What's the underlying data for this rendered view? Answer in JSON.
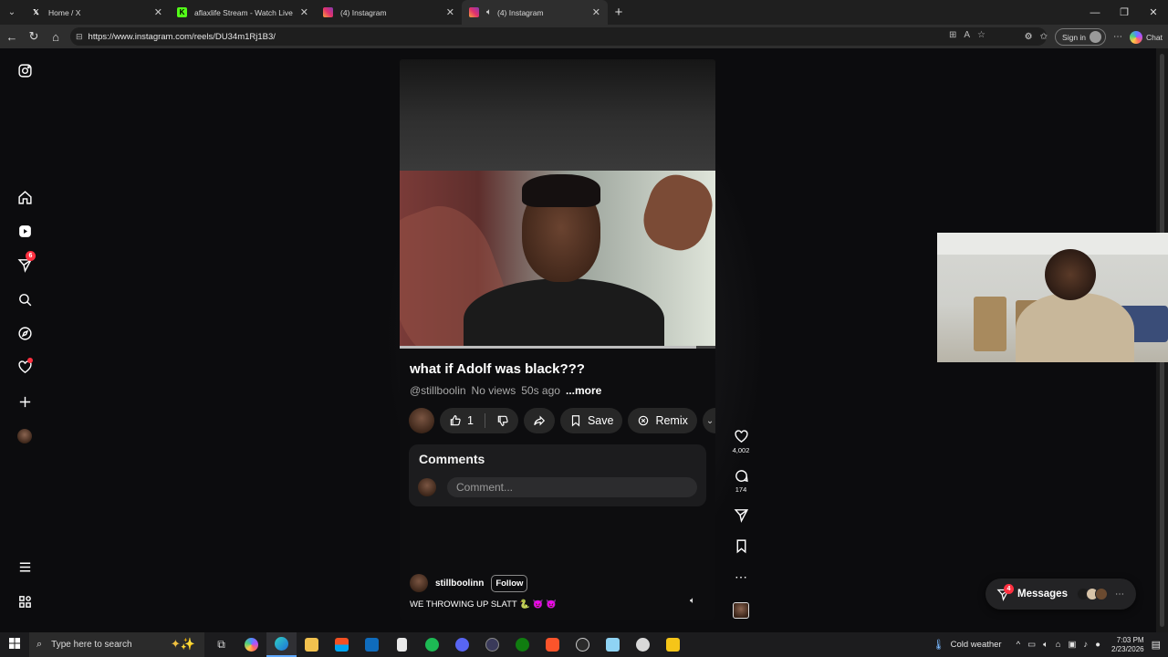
{
  "browser": {
    "tabs": [
      {
        "title": "Home / X",
        "favicon": "x-logo-icon",
        "active": false
      },
      {
        "title": "aflaxlife Stream - Watch Live on Ki",
        "favicon": "kick-logo-icon",
        "active": false
      },
      {
        "title": "(4) Instagram",
        "favicon": "instagram-logo-icon",
        "active": false
      },
      {
        "title": "(4) Instagram",
        "favicon": "instagram-logo-icon",
        "active": true
      }
    ],
    "url": "https://www.instagram.com/reels/DU34m1Rj1B3/",
    "sign_in_label": "Sign in",
    "chat_label": "Chat"
  },
  "sidebar": {
    "items": [
      {
        "name": "home",
        "icon": "home-icon"
      },
      {
        "name": "reels",
        "icon": "reels-icon"
      },
      {
        "name": "direct",
        "icon": "paper-plane-icon",
        "badge": "6"
      },
      {
        "name": "search",
        "icon": "search-icon"
      },
      {
        "name": "explore",
        "icon": "compass-icon"
      },
      {
        "name": "notifications",
        "icon": "heart-icon"
      },
      {
        "name": "create",
        "icon": "plus-icon"
      },
      {
        "name": "profile",
        "icon": "avatar"
      }
    ]
  },
  "reel": {
    "title": "what if Adolf was black???",
    "handle": "@stillboolin",
    "views": "No views",
    "age": "50s ago",
    "more_label": "...more",
    "like_count": "1",
    "save_label": "Save",
    "remix_label": "Remix",
    "comments_heading": "Comments",
    "comment_placeholder": "Comment...",
    "owner_name": "stillboolinn",
    "follow_label": "Follow",
    "caption": "WE THROWING UP SLATT 🐍 😈 😈",
    "progress": 0.94
  },
  "side_actions": {
    "likes": "4,002",
    "comments": "174"
  },
  "messages": {
    "label": "Messages",
    "badge": "4"
  },
  "taskbar": {
    "search_placeholder": "Type here to search",
    "weather": "Cold weather",
    "time": "7:03 PM",
    "date": "2/23/2026"
  },
  "colors": {
    "badge_red": "#ff3040",
    "accent_blue": "#5fa8ff"
  }
}
